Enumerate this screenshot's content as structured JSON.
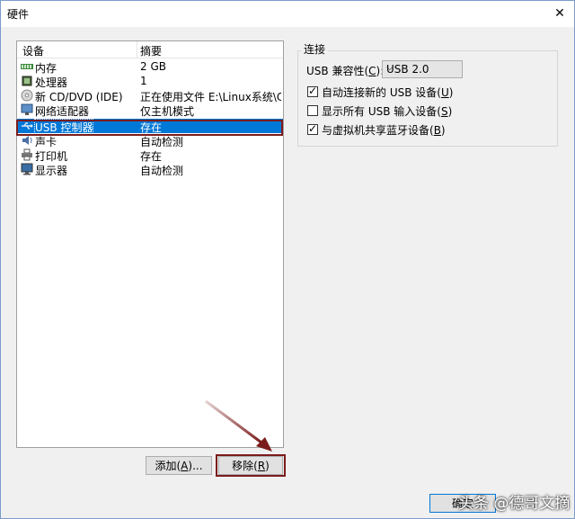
{
  "window": {
    "title": "硬件",
    "close_symbol": "✕"
  },
  "device_table": {
    "headers": [
      "设备",
      "摘要"
    ],
    "rows": [
      {
        "icon": "memory-icon",
        "name": "内存",
        "summary": "2 GB"
      },
      {
        "icon": "processor-icon",
        "name": "处理器",
        "summary": "1"
      },
      {
        "icon": "cd-dvd-icon",
        "name": "新 CD/DVD (IDE)",
        "summary": "正在使用文件 E:\\Linux系统\\C..."
      },
      {
        "icon": "network-adapter-icon",
        "name": "网络适配器",
        "summary": "仅主机模式"
      },
      {
        "icon": "usb-controller-icon",
        "name": "USB 控制器",
        "summary": "存在",
        "selected": true
      },
      {
        "icon": "sound-card-icon",
        "name": "声卡",
        "summary": "自动检测"
      },
      {
        "icon": "printer-icon",
        "name": "打印机",
        "summary": "存在"
      },
      {
        "icon": "display-icon",
        "name": "显示器",
        "summary": "自动检测"
      }
    ]
  },
  "buttons": {
    "add_text": "添加(",
    "add_key": "A",
    "add_tail": ")...",
    "remove_text": "移除(",
    "remove_key": "R",
    "remove_tail": ")"
  },
  "connection": {
    "group_title": "连接",
    "usb_compat_label": "USB 兼容性(",
    "usb_compat_key": "C",
    "usb_compat_tail": "):",
    "usb_compat_value": "USB 2.0",
    "options": [
      {
        "text": "自动连接新的 USB 设备(",
        "key": "U",
        "tail": ")",
        "checked": true
      },
      {
        "text": "显示所有 USB 输入设备(",
        "key": "S",
        "tail": ")",
        "checked": false
      },
      {
        "text": "与虚拟机共享蓝牙设备(",
        "key": "B",
        "tail": ")",
        "checked": true
      }
    ]
  },
  "footer": {
    "ok_partial": "确定",
    "watermark": "头条 @德哥文摘"
  },
  "colors": {
    "selection": "#0078d7",
    "annotation": "#7b1c1c"
  }
}
